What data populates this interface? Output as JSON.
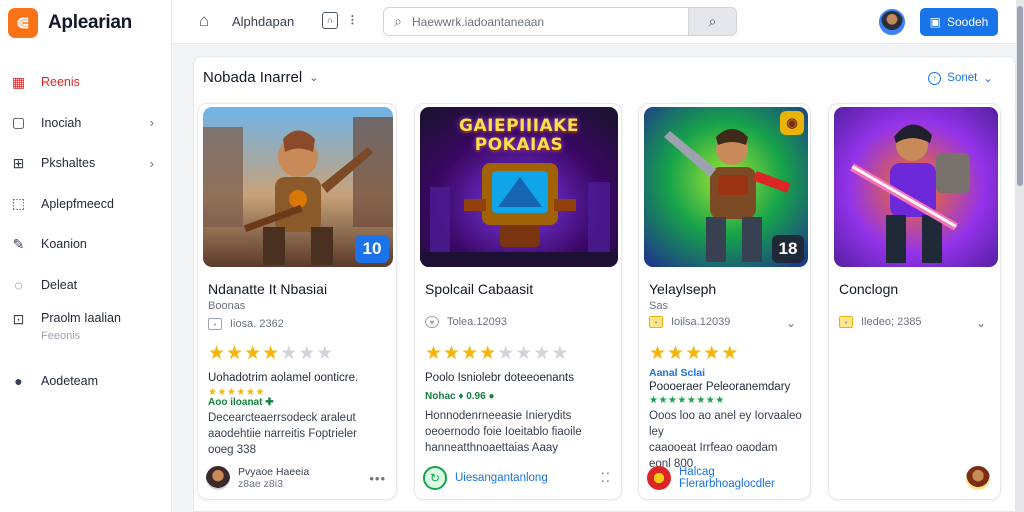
{
  "app": {
    "logo_glyph": "⋐",
    "name": "Aplearian",
    "accent": "#f97316"
  },
  "sidebar": {
    "items": [
      {
        "label": "Reenis",
        "icon": "calendar-icon",
        "glyph": "▦",
        "active": true,
        "chevron": false
      },
      {
        "label": "Inociah",
        "icon": "square-icon",
        "glyph": "▢",
        "active": false,
        "chevron": true
      },
      {
        "label": "Pkshaltes",
        "icon": "grid-icon",
        "glyph": "⊞",
        "active": false,
        "chevron": true
      },
      {
        "label": "Aplepfmeecd",
        "icon": "chart-icon",
        "glyph": "⬚",
        "active": false,
        "chevron": false
      },
      {
        "label": "Koanion",
        "icon": "pencil-icon",
        "glyph": "✎",
        "active": false,
        "chevron": false
      },
      {
        "label": "Deleat",
        "icon": "shield-icon",
        "glyph": "◌",
        "active": false,
        "chevron": false
      },
      {
        "label": "Praolm Iaalian",
        "sublabel": "Feeonis",
        "icon": "photo-icon",
        "glyph": "⊡",
        "active": false,
        "chevron": false
      },
      {
        "label": "Aodeteam",
        "icon": "info-icon",
        "glyph": "●",
        "active": false,
        "chevron": false
      }
    ],
    "active_color": "#dc2626"
  },
  "topbar": {
    "breadcrumb": "Alphdapan",
    "search_placeholder": "Haewwrk.iadoantaneaan",
    "primary_button": "Soodeh"
  },
  "panel": {
    "title": "Nobada Inarrel",
    "sort_label": "Sonet"
  },
  "cards": [
    {
      "title": "Ndanatte It Nbasiai",
      "subtitle": "Boonas",
      "meta": "Iiosa.  2362",
      "badge": "10",
      "rating": 3,
      "line1": "Uohadotrim aolamel oonticre.",
      "mini_stars": "★★★★★★",
      "tag": "Aoo iloanat ✚",
      "desc": [
        "Decearcteaerrsodeck araleut",
        "aaodehtiie narreitis Foptrieler",
        "ooeg  338"
      ],
      "footer_text": [
        "Pvyaoe Haeeia",
        "z8ae  z8i3"
      ],
      "footer_more": "•••"
    },
    {
      "title": "Spolcail Cabaasit",
      "meta": "Tolea.12093",
      "overlay_title": [
        "GAIEPIIIAKE",
        "POKAIAS"
      ],
      "rating": 3,
      "line1": "Poolo Isniolebr doteeoenants",
      "tag": "Nohac  ♦ 0.96  ●",
      "desc": [
        "Honnodenrneeasie Inierydits",
        "oeoernodo  foie Ioeitablo  fiaoile",
        "hanneatthnoaettaias  Aaay"
      ],
      "footer_text": [
        "Uiesangantanlong"
      ],
      "footer_more": "⁚⁚"
    },
    {
      "title": "Yelaylseph",
      "subtitle": "Sas",
      "meta": "Ioilsa.12039",
      "badge": "18",
      "rating": 5,
      "blue_tag": "Aanal Sclai",
      "line1": "Poooeraer Peleoranemdary",
      "mini_stars": "★★★★★★★★",
      "desc": [
        "Ooos loo ao anel ey Iorvaaleo ley",
        "caaooeat Irrfeao oaodam",
        "eonl  800"
      ],
      "footer_text": [
        "Halcag Flerarbhoaglocdler"
      ]
    },
    {
      "title": "Conclogn",
      "meta": "Iledeo;  2385",
      "rating": 0
    }
  ]
}
